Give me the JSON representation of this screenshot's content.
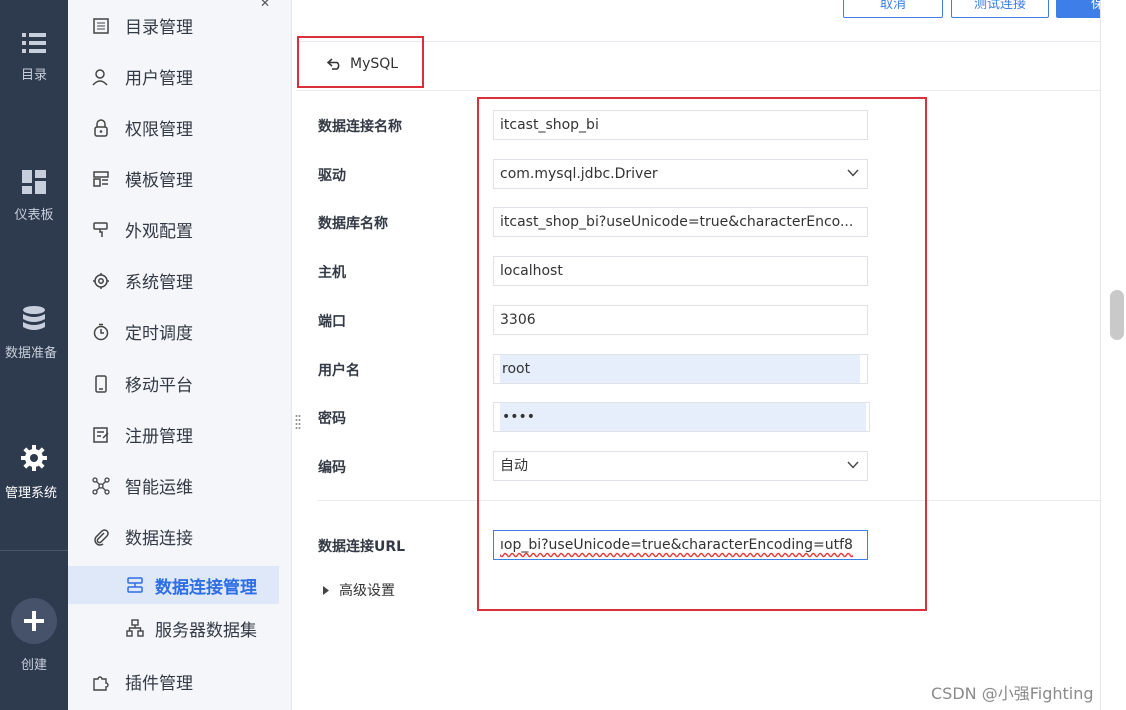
{
  "rail": {
    "items": [
      {
        "label": "目录",
        "icon": "list-icon"
      },
      {
        "label": "仪表板",
        "icon": "dashboard-icon"
      },
      {
        "label": "数据准备",
        "icon": "database-icon"
      },
      {
        "label": "管理系统",
        "icon": "gear-icon",
        "active": true
      },
      {
        "label": "创建",
        "icon": "plus-icon"
      }
    ]
  },
  "nav": {
    "items": [
      {
        "label": "目录管理",
        "icon": "catalog-icon"
      },
      {
        "label": "用户管理",
        "icon": "user-icon"
      },
      {
        "label": "权限管理",
        "icon": "lock-icon"
      },
      {
        "label": "模板管理",
        "icon": "template-icon"
      },
      {
        "label": "外观配置",
        "icon": "brush-icon"
      },
      {
        "label": "系统管理",
        "icon": "gear-icon"
      },
      {
        "label": "定时调度",
        "icon": "timer-icon"
      },
      {
        "label": "移动平台",
        "icon": "mobile-icon"
      },
      {
        "label": "注册管理",
        "icon": "register-icon"
      },
      {
        "label": "智能运维",
        "icon": "network-icon"
      },
      {
        "label": "数据连接",
        "icon": "paperclip-icon"
      },
      {
        "label": "插件管理",
        "icon": "puzzle-icon"
      }
    ],
    "sub_items": [
      {
        "label": "数据连接管理",
        "icon": "connection-icon",
        "active": true
      },
      {
        "label": "服务器数据集",
        "icon": "server-dataset-icon"
      }
    ]
  },
  "toolbar": {
    "cancel_label": "取消",
    "test_label": "测试连接",
    "save_label": "保"
  },
  "header": {
    "back_label": "MySQL"
  },
  "form": {
    "name_label": "数据连接名称",
    "name_value": "itcast_shop_bi",
    "driver_label": "驱动",
    "driver_value": "com.mysql.jdbc.Driver",
    "db_label": "数据库名称",
    "db_value": "itcast_shop_bi?useUnicode=true&characterEnco...",
    "host_label": "主机",
    "host_value": "localhost",
    "port_label": "端口",
    "port_value": "3306",
    "user_label": "用户名",
    "user_value": "root",
    "password_label": "密码",
    "password_value": "••••",
    "encoding_label": "编码",
    "encoding_value": "自动",
    "url_label": "数据连接URL",
    "url_value": "ıop_bi?useUnicode=true&characterEncoding=utf8",
    "advanced_label": "高级设置"
  },
  "watermark": "CSDN @小强Fighting",
  "colors": {
    "accent": "#3d7ee8",
    "highlight_red": "#d9303a",
    "rail_bg": "#2e3a4e",
    "nav_active_bg": "#dfe8f9"
  }
}
